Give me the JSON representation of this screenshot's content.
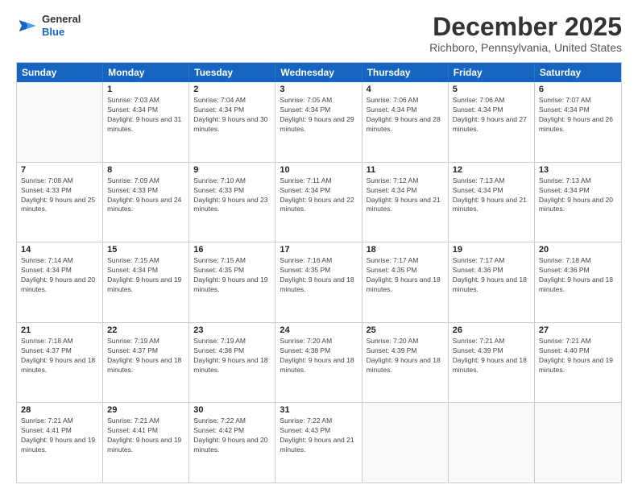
{
  "header": {
    "logo_general": "General",
    "logo_blue": "Blue",
    "month_title": "December 2025",
    "location": "Richboro, Pennsylvania, United States"
  },
  "days_of_week": [
    "Sunday",
    "Monday",
    "Tuesday",
    "Wednesday",
    "Thursday",
    "Friday",
    "Saturday"
  ],
  "weeks": [
    [
      {
        "date": "",
        "sunrise": "",
        "sunset": "",
        "daylight": "",
        "empty": true
      },
      {
        "date": "1",
        "sunrise": "Sunrise: 7:03 AM",
        "sunset": "Sunset: 4:34 PM",
        "daylight": "Daylight: 9 hours and 31 minutes.",
        "empty": false
      },
      {
        "date": "2",
        "sunrise": "Sunrise: 7:04 AM",
        "sunset": "Sunset: 4:34 PM",
        "daylight": "Daylight: 9 hours and 30 minutes.",
        "empty": false
      },
      {
        "date": "3",
        "sunrise": "Sunrise: 7:05 AM",
        "sunset": "Sunset: 4:34 PM",
        "daylight": "Daylight: 9 hours and 29 minutes.",
        "empty": false
      },
      {
        "date": "4",
        "sunrise": "Sunrise: 7:06 AM",
        "sunset": "Sunset: 4:34 PM",
        "daylight": "Daylight: 9 hours and 28 minutes.",
        "empty": false
      },
      {
        "date": "5",
        "sunrise": "Sunrise: 7:06 AM",
        "sunset": "Sunset: 4:34 PM",
        "daylight": "Daylight: 9 hours and 27 minutes.",
        "empty": false
      },
      {
        "date": "6",
        "sunrise": "Sunrise: 7:07 AM",
        "sunset": "Sunset: 4:34 PM",
        "daylight": "Daylight: 9 hours and 26 minutes.",
        "empty": false
      }
    ],
    [
      {
        "date": "7",
        "sunrise": "Sunrise: 7:08 AM",
        "sunset": "Sunset: 4:33 PM",
        "daylight": "Daylight: 9 hours and 25 minutes.",
        "empty": false
      },
      {
        "date": "8",
        "sunrise": "Sunrise: 7:09 AM",
        "sunset": "Sunset: 4:33 PM",
        "daylight": "Daylight: 9 hours and 24 minutes.",
        "empty": false
      },
      {
        "date": "9",
        "sunrise": "Sunrise: 7:10 AM",
        "sunset": "Sunset: 4:33 PM",
        "daylight": "Daylight: 9 hours and 23 minutes.",
        "empty": false
      },
      {
        "date": "10",
        "sunrise": "Sunrise: 7:11 AM",
        "sunset": "Sunset: 4:34 PM",
        "daylight": "Daylight: 9 hours and 22 minutes.",
        "empty": false
      },
      {
        "date": "11",
        "sunrise": "Sunrise: 7:12 AM",
        "sunset": "Sunset: 4:34 PM",
        "daylight": "Daylight: 9 hours and 21 minutes.",
        "empty": false
      },
      {
        "date": "12",
        "sunrise": "Sunrise: 7:13 AM",
        "sunset": "Sunset: 4:34 PM",
        "daylight": "Daylight: 9 hours and 21 minutes.",
        "empty": false
      },
      {
        "date": "13",
        "sunrise": "Sunrise: 7:13 AM",
        "sunset": "Sunset: 4:34 PM",
        "daylight": "Daylight: 9 hours and 20 minutes.",
        "empty": false
      }
    ],
    [
      {
        "date": "14",
        "sunrise": "Sunrise: 7:14 AM",
        "sunset": "Sunset: 4:34 PM",
        "daylight": "Daylight: 9 hours and 20 minutes.",
        "empty": false
      },
      {
        "date": "15",
        "sunrise": "Sunrise: 7:15 AM",
        "sunset": "Sunset: 4:34 PM",
        "daylight": "Daylight: 9 hours and 19 minutes.",
        "empty": false
      },
      {
        "date": "16",
        "sunrise": "Sunrise: 7:15 AM",
        "sunset": "Sunset: 4:35 PM",
        "daylight": "Daylight: 9 hours and 19 minutes.",
        "empty": false
      },
      {
        "date": "17",
        "sunrise": "Sunrise: 7:16 AM",
        "sunset": "Sunset: 4:35 PM",
        "daylight": "Daylight: 9 hours and 18 minutes.",
        "empty": false
      },
      {
        "date": "18",
        "sunrise": "Sunrise: 7:17 AM",
        "sunset": "Sunset: 4:35 PM",
        "daylight": "Daylight: 9 hours and 18 minutes.",
        "empty": false
      },
      {
        "date": "19",
        "sunrise": "Sunrise: 7:17 AM",
        "sunset": "Sunset: 4:36 PM",
        "daylight": "Daylight: 9 hours and 18 minutes.",
        "empty": false
      },
      {
        "date": "20",
        "sunrise": "Sunrise: 7:18 AM",
        "sunset": "Sunset: 4:36 PM",
        "daylight": "Daylight: 9 hours and 18 minutes.",
        "empty": false
      }
    ],
    [
      {
        "date": "21",
        "sunrise": "Sunrise: 7:18 AM",
        "sunset": "Sunset: 4:37 PM",
        "daylight": "Daylight: 9 hours and 18 minutes.",
        "empty": false
      },
      {
        "date": "22",
        "sunrise": "Sunrise: 7:19 AM",
        "sunset": "Sunset: 4:37 PM",
        "daylight": "Daylight: 9 hours and 18 minutes.",
        "empty": false
      },
      {
        "date": "23",
        "sunrise": "Sunrise: 7:19 AM",
        "sunset": "Sunset: 4:38 PM",
        "daylight": "Daylight: 9 hours and 18 minutes.",
        "empty": false
      },
      {
        "date": "24",
        "sunrise": "Sunrise: 7:20 AM",
        "sunset": "Sunset: 4:38 PM",
        "daylight": "Daylight: 9 hours and 18 minutes.",
        "empty": false
      },
      {
        "date": "25",
        "sunrise": "Sunrise: 7:20 AM",
        "sunset": "Sunset: 4:39 PM",
        "daylight": "Daylight: 9 hours and 18 minutes.",
        "empty": false
      },
      {
        "date": "26",
        "sunrise": "Sunrise: 7:21 AM",
        "sunset": "Sunset: 4:39 PM",
        "daylight": "Daylight: 9 hours and 18 minutes.",
        "empty": false
      },
      {
        "date": "27",
        "sunrise": "Sunrise: 7:21 AM",
        "sunset": "Sunset: 4:40 PM",
        "daylight": "Daylight: 9 hours and 19 minutes.",
        "empty": false
      }
    ],
    [
      {
        "date": "28",
        "sunrise": "Sunrise: 7:21 AM",
        "sunset": "Sunset: 4:41 PM",
        "daylight": "Daylight: 9 hours and 19 minutes.",
        "empty": false
      },
      {
        "date": "29",
        "sunrise": "Sunrise: 7:21 AM",
        "sunset": "Sunset: 4:41 PM",
        "daylight": "Daylight: 9 hours and 19 minutes.",
        "empty": false
      },
      {
        "date": "30",
        "sunrise": "Sunrise: 7:22 AM",
        "sunset": "Sunset: 4:42 PM",
        "daylight": "Daylight: 9 hours and 20 minutes.",
        "empty": false
      },
      {
        "date": "31",
        "sunrise": "Sunrise: 7:22 AM",
        "sunset": "Sunset: 4:43 PM",
        "daylight": "Daylight: 9 hours and 21 minutes.",
        "empty": false
      },
      {
        "date": "",
        "sunrise": "",
        "sunset": "",
        "daylight": "",
        "empty": true
      },
      {
        "date": "",
        "sunrise": "",
        "sunset": "",
        "daylight": "",
        "empty": true
      },
      {
        "date": "",
        "sunrise": "",
        "sunset": "",
        "daylight": "",
        "empty": true
      }
    ]
  ]
}
